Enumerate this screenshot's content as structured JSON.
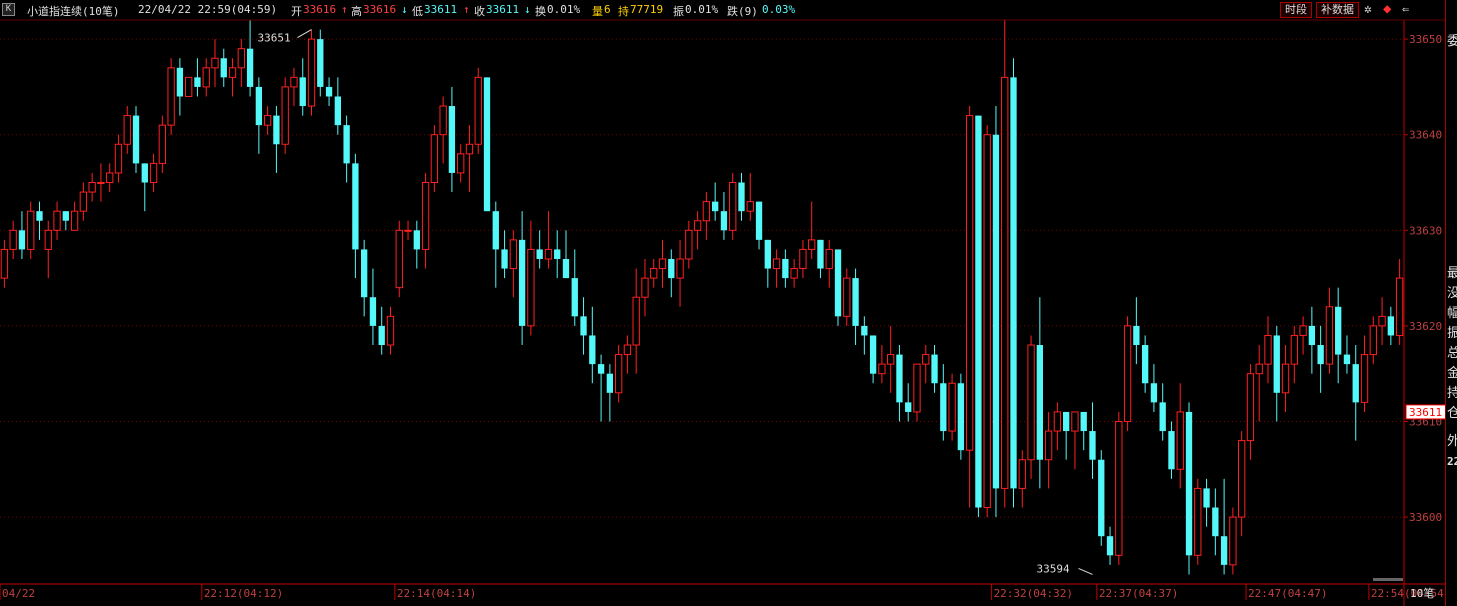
{
  "header": {
    "k_icon": "K",
    "title": "小道指连续(10笔)",
    "datetime": "22/04/22 22:59(04:59)",
    "open_label": "开",
    "open": "33616",
    "high_label": "高",
    "high": "33616",
    "low_label": "低",
    "low": "33611",
    "close_label": "收",
    "close": "33611",
    "turnover_label": "换",
    "turnover": "0.01%",
    "volume_label": "量",
    "volume": "6",
    "hold_label": "持",
    "hold": "77719",
    "amplitude_label": "振",
    "amplitude": "0.01%",
    "change_label": "跌(9)",
    "change": "0.03%",
    "btn_timeshare": "时段",
    "btn_fill": "补数据"
  },
  "right_panel": {
    "chars": [
      "委",
      "最",
      "没",
      "幅",
      "振",
      "总",
      "金",
      "持",
      "仓",
      "外"
    ],
    "num": "22"
  },
  "colors": {
    "up": "#ff2020",
    "down": "#54f8f8",
    "axis": "#c00000",
    "grid": "#7a0000",
    "text": "#c0c0c0"
  },
  "chart_data": {
    "type": "candlestick",
    "ylim": [
      33593,
      33652
    ],
    "y_ticks": [
      33600,
      33610,
      33620,
      33630,
      33640,
      33650
    ],
    "y_tick_labels": [
      "33600",
      "33610",
      "33620",
      "33630",
      "33640",
      "33650"
    ],
    "last_price_label": "33611",
    "last_price": 33611,
    "max_annotation": {
      "index": 35,
      "value": 33651,
      "label": "33651"
    },
    "min_annotation": {
      "index": 124,
      "value": 33594,
      "label": "33594"
    },
    "x_labels": [
      {
        "index": 0,
        "label": "04/22"
      },
      {
        "index": 23,
        "label": "22:12(04:12)"
      },
      {
        "index": 45,
        "label": "22:14(04:14)"
      },
      {
        "index": 113,
        "label": "22:32(04:32)"
      },
      {
        "index": 125,
        "label": "22:37(04:37)"
      },
      {
        "index": 142,
        "label": "22:47(04:47)"
      },
      {
        "index": 156,
        "label": "22:54(04:54)"
      }
    ],
    "x_axis_right_label": "10笔",
    "candles": [
      [
        33625,
        33629,
        33624,
        33628
      ],
      [
        33628,
        33631,
        33627,
        33630
      ],
      [
        33630,
        33632,
        33627,
        33628
      ],
      [
        33628,
        33633,
        33627,
        33632
      ],
      [
        33632,
        33633,
        33629,
        33631
      ],
      [
        33628,
        33631,
        33625,
        33630
      ],
      [
        33630,
        33633,
        33629,
        33632
      ],
      [
        33632,
        33632,
        33630,
        33631
      ],
      [
        33630,
        33633,
        33630,
        33632
      ],
      [
        33632,
        33635,
        33631,
        33634
      ],
      [
        33634,
        33636,
        33633,
        33635
      ],
      [
        33635,
        33637,
        33633,
        33635
      ],
      [
        33635,
        33637,
        33634,
        33636
      ],
      [
        33636,
        33640,
        33635,
        33639
      ],
      [
        33639,
        33643,
        33638,
        33642
      ],
      [
        33642,
        33643,
        33636,
        33637
      ],
      [
        33637,
        33637,
        33632,
        33635
      ],
      [
        33635,
        33638,
        33634,
        33637
      ],
      [
        33637,
        33642,
        33636,
        33641
      ],
      [
        33641,
        33648,
        33640,
        33647
      ],
      [
        33647,
        33648,
        33642,
        33644
      ],
      [
        33644,
        33646,
        33644,
        33646
      ],
      [
        33646,
        33648,
        33644,
        33645
      ],
      [
        33645,
        33648,
        33644,
        33647
      ],
      [
        33647,
        33650,
        33645,
        33648
      ],
      [
        33648,
        33649,
        33645,
        33646
      ],
      [
        33646,
        33648,
        33644,
        33647
      ],
      [
        33647,
        33650,
        33645,
        33649
      ],
      [
        33649,
        33652,
        33644,
        33645
      ],
      [
        33645,
        33646,
        33638,
        33641
      ],
      [
        33641,
        33643,
        33640,
        33642
      ],
      [
        33642,
        33643,
        33636,
        33639
      ],
      [
        33639,
        33646,
        33638,
        33645
      ],
      [
        33645,
        33647,
        33643,
        33646
      ],
      [
        33646,
        33648,
        33642,
        33643
      ],
      [
        33643,
        33651,
        33642,
        33650
      ],
      [
        33650,
        33651,
        33644,
        33645
      ],
      [
        33645,
        33646,
        33643,
        33644
      ],
      [
        33644,
        33646,
        33640,
        33641
      ],
      [
        33641,
        33642,
        33635,
        33637
      ],
      [
        33637,
        33638,
        33625,
        33628
      ],
      [
        33628,
        33629,
        33621,
        33623
      ],
      [
        33623,
        33626,
        33618,
        33620
      ],
      [
        33620,
        33622,
        33617,
        33618
      ],
      [
        33618,
        33622,
        33617,
        33621
      ],
      [
        33624,
        33631,
        33623,
        33630
      ],
      [
        33630,
        33631,
        33629,
        33630
      ],
      [
        33630,
        33631,
        33626,
        33628
      ],
      [
        33628,
        33636,
        33626,
        33635
      ],
      [
        33635,
        33641,
        33634,
        33640
      ],
      [
        33640,
        33644,
        33637,
        33643
      ],
      [
        33643,
        33645,
        33634,
        33636
      ],
      [
        33636,
        33639,
        33635,
        33638
      ],
      [
        33638,
        33641,
        33634,
        33639
      ],
      [
        33639,
        33647,
        33638,
        33646
      ],
      [
        33646,
        33646,
        33632,
        33632
      ],
      [
        33632,
        33633,
        33624,
        33628
      ],
      [
        33628,
        33630,
        33625,
        33626
      ],
      [
        33626,
        33630,
        33623,
        33629
      ],
      [
        33629,
        33632,
        33618,
        33620
      ],
      [
        33620,
        33631,
        33619,
        33628
      ],
      [
        33628,
        33630,
        33626,
        33627
      ],
      [
        33627,
        33632,
        33626,
        33628
      ],
      [
        33628,
        33630,
        33625,
        33627
      ],
      [
        33627,
        33630,
        33625,
        33625
      ],
      [
        33625,
        33628,
        33620,
        33621
      ],
      [
        33621,
        33623,
        33617,
        33619
      ],
      [
        33619,
        33622,
        33614,
        33616
      ],
      [
        33616,
        33617,
        33610,
        33615
      ],
      [
        33615,
        33616,
        33610,
        33613
      ],
      [
        33613,
        33618,
        33612,
        33617
      ],
      [
        33617,
        33619,
        33615,
        33618
      ],
      [
        33618,
        33626,
        33615,
        33623
      ],
      [
        33623,
        33627,
        33621,
        33625
      ],
      [
        33625,
        33627,
        33624,
        33626
      ],
      [
        33626,
        33629,
        33624,
        33627
      ],
      [
        33627,
        33628,
        33623,
        33625
      ],
      [
        33625,
        33629,
        33622,
        33627
      ],
      [
        33627,
        33631,
        33626,
        33630
      ],
      [
        33630,
        33632,
        33628,
        33631
      ],
      [
        33631,
        33634,
        33629,
        33633
      ],
      [
        33633,
        33635,
        33631,
        33632
      ],
      [
        33632,
        33634,
        33629,
        33630
      ],
      [
        33630,
        33636,
        33629,
        33635
      ],
      [
        33635,
        33636,
        33631,
        33632
      ],
      [
        33632,
        33636,
        33631,
        33633
      ],
      [
        33633,
        33633,
        33628,
        33629
      ],
      [
        33629,
        33629,
        33624,
        33626
      ],
      [
        33626,
        33628,
        33624,
        33627
      ],
      [
        33627,
        33628,
        33624,
        33625
      ],
      [
        33625,
        33627,
        33624,
        33626
      ],
      [
        33626,
        33629,
        33625,
        33628
      ],
      [
        33628,
        33633,
        33627,
        33629
      ],
      [
        33629,
        33629,
        33625,
        33626
      ],
      [
        33626,
        33629,
        33624,
        33628
      ],
      [
        33628,
        33628,
        33620,
        33621
      ],
      [
        33621,
        33626,
        33620,
        33625
      ],
      [
        33625,
        33626,
        33618,
        33620
      ],
      [
        33620,
        33621,
        33617,
        33619
      ],
      [
        33619,
        33619,
        33614,
        33615
      ],
      [
        33615,
        33618,
        33614,
        33616
      ],
      [
        33616,
        33620,
        33613,
        33617
      ],
      [
        33617,
        33618,
        33610,
        33612
      ],
      [
        33612,
        33614,
        33610,
        33611
      ],
      [
        33611,
        33616,
        33610,
        33616
      ],
      [
        33616,
        33618,
        33614,
        33617
      ],
      [
        33617,
        33618,
        33613,
        33614
      ],
      [
        33614,
        33616,
        33608,
        33609
      ],
      [
        33609,
        33615,
        33608,
        33614
      ],
      [
        33614,
        33615,
        33606,
        33607
      ],
      [
        33607,
        33643,
        33601,
        33642
      ],
      [
        33642,
        33642,
        33600,
        33601
      ],
      [
        33601,
        33641,
        33600,
        33640
      ],
      [
        33640,
        33643,
        33600,
        33603
      ],
      [
        33603,
        33652,
        33601,
        33646
      ],
      [
        33646,
        33648,
        33601,
        33603
      ],
      [
        33603,
        33607,
        33601,
        33606
      ],
      [
        33606,
        33619,
        33604,
        33618
      ],
      [
        33618,
        33623,
        33603,
        33606
      ],
      [
        33606,
        33611,
        33603,
        33609
      ],
      [
        33609,
        33612,
        33607,
        33611
      ],
      [
        33611,
        33611,
        33606,
        33609
      ],
      [
        33609,
        33611,
        33605,
        33611
      ],
      [
        33611,
        33611,
        33607,
        33609
      ],
      [
        33609,
        33612,
        33604,
        33606
      ],
      [
        33606,
        33607,
        33597,
        33598
      ],
      [
        33598,
        33599,
        33595,
        33596
      ],
      [
        33596,
        33611,
        33595,
        33610
      ],
      [
        33610,
        33621,
        33609,
        33620
      ],
      [
        33620,
        33623,
        33616,
        33618
      ],
      [
        33618,
        33619,
        33613,
        33614
      ],
      [
        33614,
        33616,
        33611,
        33612
      ],
      [
        33612,
        33614,
        33608,
        33609
      ],
      [
        33609,
        33610,
        33604,
        33605
      ],
      [
        33605,
        33614,
        33603,
        33611
      ],
      [
        33611,
        33612,
        33594,
        33596
      ],
      [
        33596,
        33604,
        33595,
        33603
      ],
      [
        33603,
        33604,
        33599,
        33601
      ],
      [
        33601,
        33603,
        33596,
        33598
      ],
      [
        33598,
        33604,
        33594,
        33595
      ],
      [
        33595,
        33601,
        33594,
        33600
      ],
      [
        33600,
        33609,
        33598,
        33608
      ],
      [
        33608,
        33616,
        33606,
        33615
      ],
      [
        33615,
        33618,
        33610,
        33616
      ],
      [
        33616,
        33621,
        33614,
        33619
      ],
      [
        33619,
        33620,
        33610,
        33613
      ],
      [
        33613,
        33618,
        33611,
        33616
      ],
      [
        33616,
        33620,
        33614,
        33619
      ],
      [
        33619,
        33621,
        33617,
        33620
      ],
      [
        33620,
        33622,
        33615,
        33618
      ],
      [
        33618,
        33620,
        33613,
        33616
      ],
      [
        33616,
        33624,
        33615,
        33622
      ],
      [
        33622,
        33624,
        33614,
        33617
      ],
      [
        33617,
        33619,
        33615,
        33616
      ],
      [
        33616,
        33618,
        33608,
        33612
      ],
      [
        33612,
        33619,
        33611,
        33617
      ],
      [
        33617,
        33621,
        33616,
        33620
      ],
      [
        33620,
        33623,
        33618,
        33621
      ],
      [
        33621,
        33622,
        33618,
        33619
      ],
      [
        33619,
        33627,
        33618,
        33625
      ]
    ]
  }
}
